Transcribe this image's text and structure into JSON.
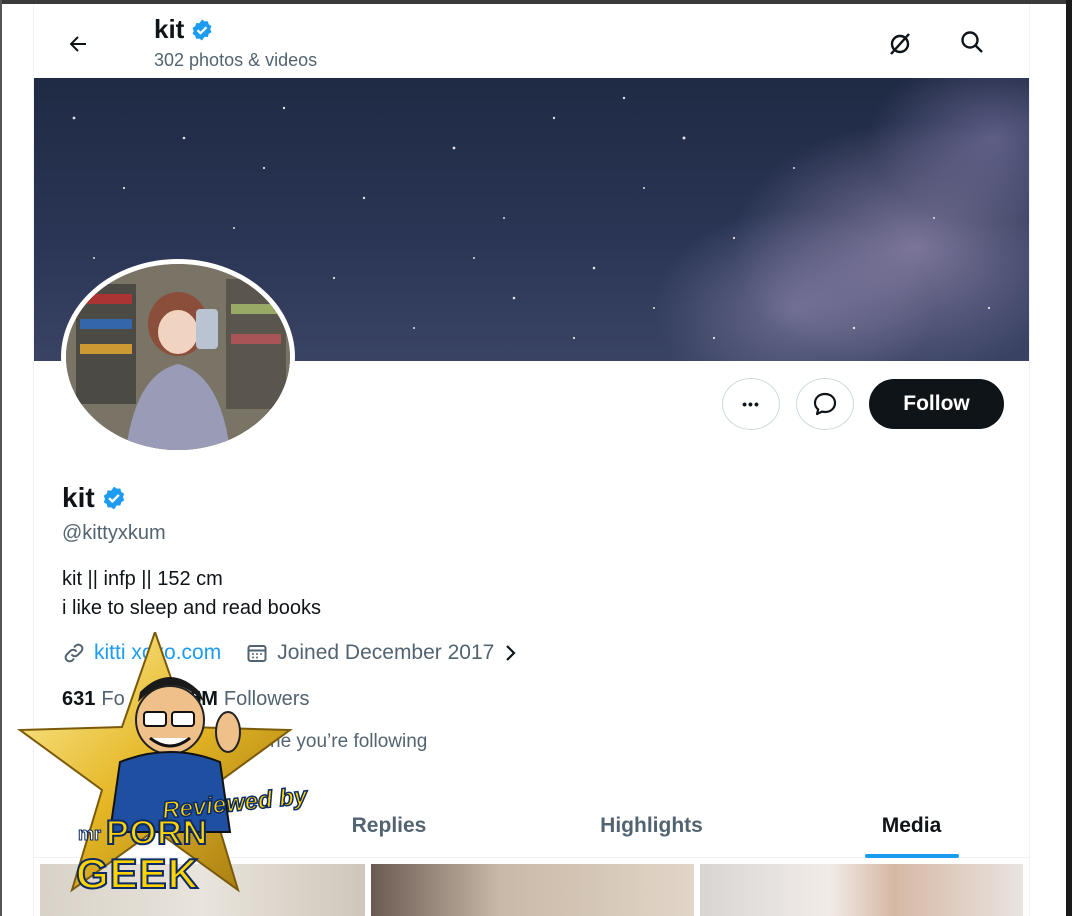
{
  "header": {
    "name": "kit",
    "subtitle": "302 photos & videos"
  },
  "actions": {
    "more_label": "•••",
    "follow_label": "Follow"
  },
  "profile": {
    "name": "kit",
    "handle": "@kittyxkum",
    "bio_line1": "kit || infp || 152 cm",
    "bio_line2": "i like to sleep and read books",
    "link": "kitti  xoxo.com",
    "joined": "Joined December 2017",
    "following_count": "631",
    "following_label": "Fo     g",
    "followers_count": "2.5M",
    "followers_label": "Followers",
    "known_followers": "ne you’re following"
  },
  "tabs": [
    {
      "label": "Replies"
    },
    {
      "label": "Highlights"
    },
    {
      "label": "Media",
      "active": true
    }
  ],
  "watermark": {
    "line1": "Reviewed by",
    "line2": "mr",
    "line3": "PORN",
    "line4": "GEEK"
  },
  "colors": {
    "accent": "#1d9bf0",
    "text": "#0f1419",
    "secondary": "#536471",
    "verified": "#1d9bf0"
  },
  "icons": {
    "back": "arrow-left-icon",
    "verified": "verified-badge-icon",
    "mute": "eye-slash-icon",
    "search": "search-icon",
    "message": "chat-bubble-icon",
    "link": "link-icon",
    "calendar": "calendar-icon"
  }
}
